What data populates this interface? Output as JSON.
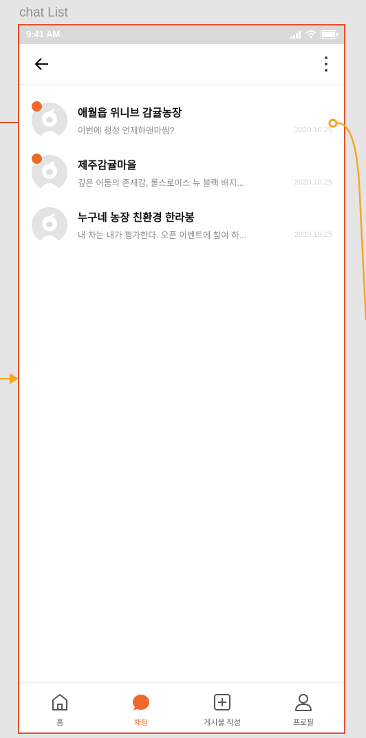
{
  "frame": {
    "label": "chat List"
  },
  "status_bar": {
    "time": "9:41 AM"
  },
  "chats": [
    {
      "name": "애월읍 위니브 감귤농장",
      "preview": "이번에 정정 언제하맨마씸?",
      "date": "2020.10.25",
      "unread": true
    },
    {
      "name": "제주감귤마을",
      "preview": "깊은 어둠의 존재감, 롤스로이스 뉴 블랙 배지...",
      "date": "2020.10.25",
      "unread": true
    },
    {
      "name": "누구네 농장 친환경 한라봉",
      "preview": "내 차는 내가 평가한다. 오픈 이벤트에 참여 하...",
      "date": "2020.10.25",
      "unread": false
    }
  ],
  "tabbar": {
    "home_label": "홈",
    "chat_label": "채팅",
    "post_label": "게시물 작성",
    "profile_label": "프로필",
    "active": "chat"
  },
  "colors": {
    "accent": "#ee6a2a",
    "frame_outline": "#e2512a",
    "connector": "#f5a623"
  }
}
